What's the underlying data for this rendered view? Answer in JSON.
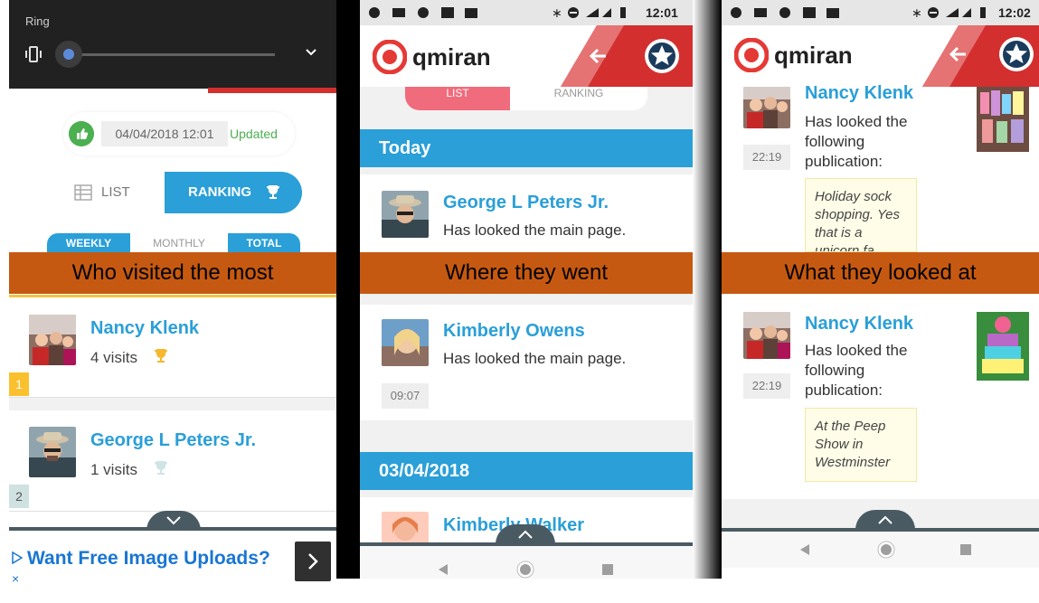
{
  "captions": {
    "visited": "Who visited the most",
    "went": "Where they went",
    "looked": "What they looked at"
  },
  "panel1": {
    "notification_title": "Ring",
    "volume_level": 0.05,
    "last_update_date": "04/04/2018 12:01",
    "last_update_status": "Updated",
    "tabs": {
      "list": "LIST",
      "ranking": "RANKING"
    },
    "period_tabs": {
      "weekly": "WEEKLY",
      "monthly": "MONTHLY",
      "total": "TOTAL"
    },
    "ranking": [
      {
        "rank": "1",
        "name": "Nancy Klenk",
        "visits": "4 visits"
      },
      {
        "rank": "2",
        "name": "George L Peters Jr.",
        "visits": "1 visits"
      }
    ],
    "ad_text": "Want Free Image Uploads?"
  },
  "panel2": {
    "status_time": "12:01",
    "logo": "qmiran",
    "tabs": {
      "list": "LIST",
      "ranking": "RANKING"
    },
    "sections": [
      {
        "title": "Today",
        "entries": [
          {
            "name": "George L Peters Jr.",
            "activity": "Has looked the main page.",
            "time": ""
          },
          {
            "name": "Kimberly Owens",
            "activity": "Has looked the main page.",
            "time": "09:07"
          }
        ]
      },
      {
        "title": "03/04/2018",
        "entries": [
          {
            "name": "Kimberly Walker",
            "activity": "",
            "time": ""
          }
        ]
      }
    ]
  },
  "panel3": {
    "status_time": "12:02",
    "logo": "qmiran",
    "entries": [
      {
        "name": "Nancy Klenk",
        "activity": "Has looked the following publication:",
        "time": "22:19",
        "publication": "Holiday sock shopping. Yes that is a unicorn fa..."
      },
      {
        "name": "Nancy Klenk",
        "activity": "Has looked the following publication:",
        "time": "22:19",
        "publication": "At the Peep Show in Westminster"
      }
    ]
  },
  "colors": {
    "accent_blue": "#2a9fd8",
    "brand_red": "#d32f2f",
    "caption_orange": "#c65911",
    "success_green": "#4caf50"
  }
}
